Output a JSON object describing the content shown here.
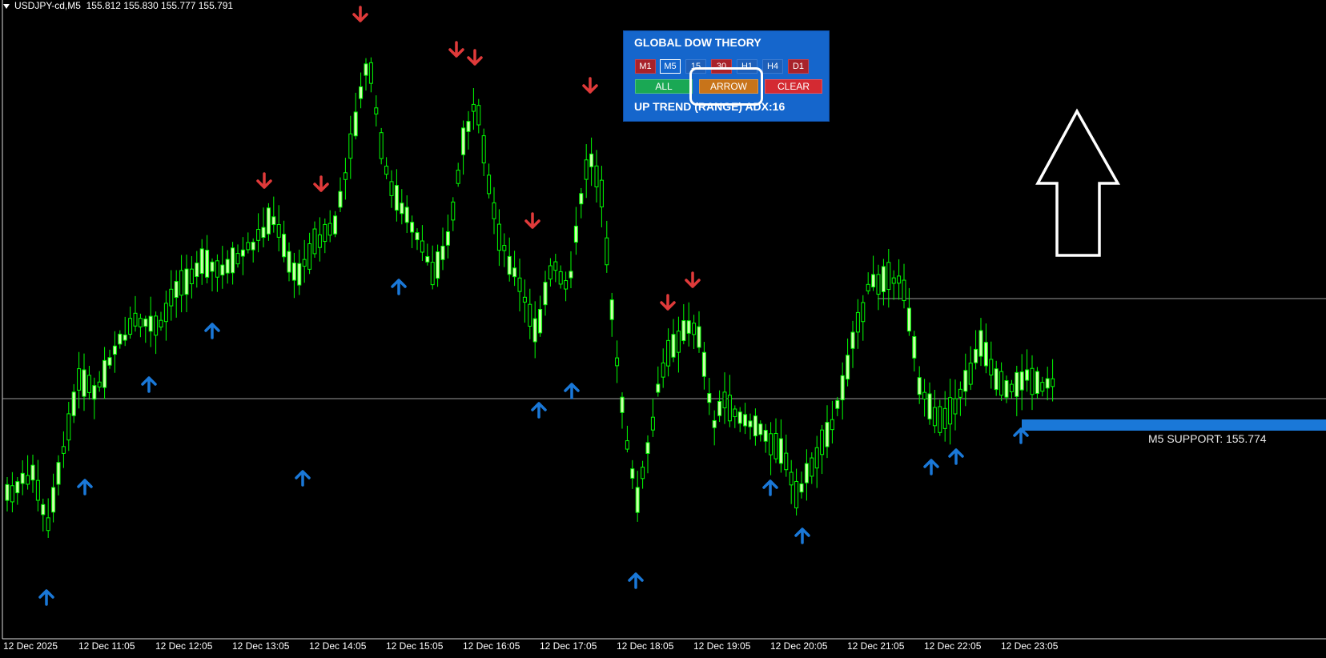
{
  "header": {
    "symbol": "USDJPY-cd,M5",
    "ohlc": "155.812 155.830 155.777 155.791"
  },
  "panel": {
    "title": "GLOBAL DOW THEORY",
    "timeframes": [
      {
        "label": "M1",
        "style": "red"
      },
      {
        "label": "M5",
        "style": "active"
      },
      {
        "label": "15",
        "style": "blue"
      },
      {
        "label": "30",
        "style": "red"
      },
      {
        "label": "H1",
        "style": "blue"
      },
      {
        "label": "H4",
        "style": "blue"
      },
      {
        "label": "D1",
        "style": "red"
      }
    ],
    "all_label": "ALL",
    "arrow_label": "ARROW",
    "clear_label": "CLEAR",
    "status": "UP TREND (RANGE)  ADX:16"
  },
  "support_label": "M5 SUPPORT: 155.774",
  "time_axis": [
    "12 Dec 2025",
    "12 Dec 11:05",
    "12 Dec 12:05",
    "12 Dec 13:05",
    "12 Dec 14:05",
    "12 Dec 15:05",
    "12 Dec 16:05",
    "12 Dec 17:05",
    "12 Dec 18:05",
    "12 Dec 19:05",
    "12 Dec 20:05",
    "12 Dec 21:05",
    "12 Dec 22:05",
    "12 Dec 23:05"
  ],
  "colors": {
    "background": "#000000",
    "candle": "#00ff00",
    "bull_fill": "#ccffaa",
    "up_arrow": "#1a78d8",
    "down_arrow": "#e03a3a",
    "support_band": "#1a78d8",
    "level_line": "#9a9a9a"
  },
  "icons": {
    "up_signal": "up-arrow-icon",
    "down_signal": "down-arrow-icon",
    "annotation": "big-up-arrow-icon"
  }
}
